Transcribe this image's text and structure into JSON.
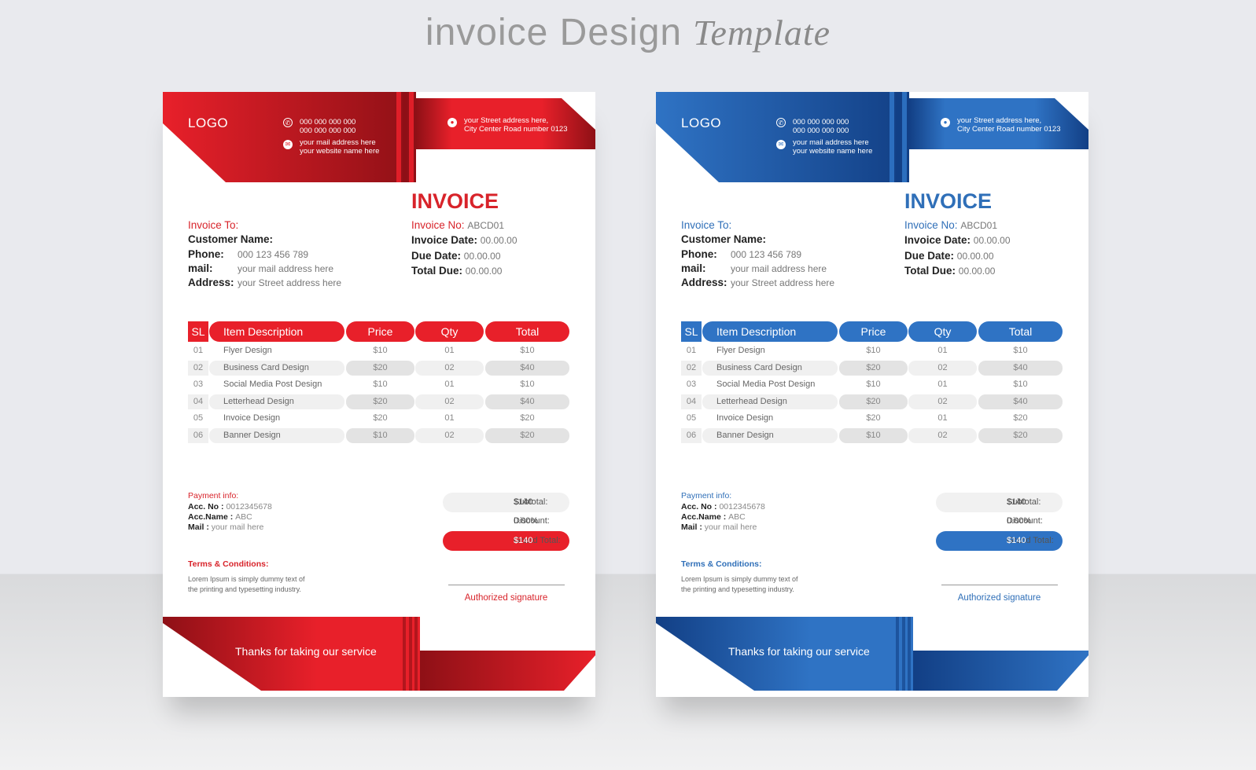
{
  "banner": {
    "title": "invoice Design",
    "script": "Template"
  },
  "invoices": [
    {
      "theme": {
        "dark": "#8e1016",
        "main": "#e8202a",
        "text": "#d8232a"
      },
      "header": {
        "logo_bold": "LO",
        "logo_light": "GO",
        "phone1": "000 000 000 000",
        "phone2": "000 000 000 000",
        "mail": "your mail address here",
        "website": "your website name here",
        "addr1": "your Street address here,",
        "addr2": "City Center Road number 0123"
      },
      "title": "INVOICE",
      "to": {
        "heading": "Invoice To:",
        "customer_label": "Customer Name:",
        "phone_label": "Phone:",
        "phone": "000 123 456 789",
        "mail_label": "mail:",
        "mail": "your mail address here",
        "address_label": "Address:",
        "address": "your Street address here"
      },
      "meta": {
        "no_label": "Invoice No:",
        "no": "ABCD01",
        "date_label": "Invoice Date:",
        "date": "00.00.00",
        "due_label": "Due Date:",
        "due": "00.00.00",
        "total_label": "Total Due:",
        "total": "00.00.00"
      },
      "table": {
        "headers": [
          "SL",
          "Item Description",
          "Price",
          "Qty",
          "Total"
        ],
        "rows": [
          [
            "01",
            "Flyer Design",
            "$10",
            "01",
            "$10"
          ],
          [
            "02",
            "Business Card Design",
            "$20",
            "02",
            "$40"
          ],
          [
            "03",
            "Social Media Post Design",
            "$10",
            "01",
            "$10"
          ],
          [
            "04",
            "Letterhead Design",
            "$20",
            "02",
            "$40"
          ],
          [
            "05",
            "Invoice Design",
            "$20",
            "01",
            "$20"
          ],
          [
            "06",
            "Banner Design",
            "$10",
            "02",
            "$20"
          ]
        ]
      },
      "payment": {
        "heading": "Payment info:",
        "acc_label": "Acc. No :",
        "acc": "0012345678",
        "name_label": "Acc.Name :",
        "name": "ABC",
        "mail_label": "Mail :",
        "mail": "your mail here"
      },
      "summary": {
        "subtotal_label": "Subtotal:",
        "subtotal": "$140",
        "discount_label": "Discount:",
        "discount": "0.00%",
        "grand_label": "Grand Total:",
        "grand": "$140"
      },
      "terms": {
        "heading": "Terms & Conditions:",
        "line1": "Lorem Ipsum is simply dummy text of",
        "line2": "the printing and typesetting industry."
      },
      "signature": "Authorized signature",
      "footer": "Thanks for taking our service"
    },
    {
      "theme": {
        "dark": "#123f85",
        "main": "#2f73c4",
        "text": "#2f6fb8"
      },
      "header": {
        "logo_bold": "LO",
        "logo_light": "GO",
        "phone1": "000 000 000 000",
        "phone2": "000 000 000 000",
        "mail": "your mail address here",
        "website": "your website name here",
        "addr1": "your Street address here,",
        "addr2": "City Center Road number 0123"
      },
      "title": "INVOICE",
      "to": {
        "heading": "Invoice To:",
        "customer_label": "Customer Name:",
        "phone_label": "Phone:",
        "phone": "000 123 456 789",
        "mail_label": "mail:",
        "mail": "your mail address here",
        "address_label": "Address:",
        "address": "your Street address here"
      },
      "meta": {
        "no_label": "Invoice No:",
        "no": "ABCD01",
        "date_label": "Invoice Date:",
        "date": "00.00.00",
        "due_label": "Due Date:",
        "due": "00.00.00",
        "total_label": "Total Due:",
        "total": "00.00.00"
      },
      "table": {
        "headers": [
          "SL",
          "Item Description",
          "Price",
          "Qty",
          "Total"
        ],
        "rows": [
          [
            "01",
            "Flyer Design",
            "$10",
            "01",
            "$10"
          ],
          [
            "02",
            "Business Card Design",
            "$20",
            "02",
            "$40"
          ],
          [
            "03",
            "Social Media Post Design",
            "$10",
            "01",
            "$10"
          ],
          [
            "04",
            "Letterhead Design",
            "$20",
            "02",
            "$40"
          ],
          [
            "05",
            "Invoice Design",
            "$20",
            "01",
            "$20"
          ],
          [
            "06",
            "Banner Design",
            "$10",
            "02",
            "$20"
          ]
        ]
      },
      "payment": {
        "heading": "Payment info:",
        "acc_label": "Acc. No :",
        "acc": "0012345678",
        "name_label": "Acc.Name :",
        "name": "ABC",
        "mail_label": "Mail :",
        "mail": "your mail here"
      },
      "summary": {
        "subtotal_label": "Subtotal:",
        "subtotal": "$140",
        "discount_label": "Discount:",
        "discount": "0.00%",
        "grand_label": "Grand Total:",
        "grand": "$140"
      },
      "terms": {
        "heading": "Terms & Conditions:",
        "line1": "Lorem Ipsum is simply dummy text of",
        "line2": "the printing and typesetting industry."
      },
      "signature": "Authorized signature",
      "footer": "Thanks for taking our service"
    }
  ]
}
